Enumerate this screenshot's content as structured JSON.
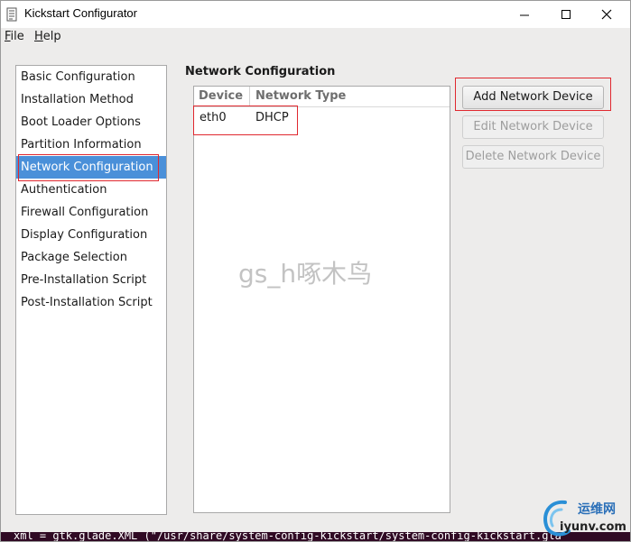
{
  "window": {
    "title": "Kickstart Configurator",
    "controls": {
      "minimize": "—",
      "maximize": "☐",
      "close": "✕"
    }
  },
  "menubar": {
    "file": {
      "mnemonic": "F",
      "rest": "ile"
    },
    "help": {
      "mnemonic": "H",
      "rest": "elp"
    }
  },
  "sidebar": {
    "items": [
      {
        "label": "Basic Configuration"
      },
      {
        "label": "Installation Method"
      },
      {
        "label": "Boot Loader Options"
      },
      {
        "label": "Partition Information"
      },
      {
        "label": "Network Configuration",
        "selected": true
      },
      {
        "label": "Authentication"
      },
      {
        "label": "Firewall Configuration"
      },
      {
        "label": "Display Configuration"
      },
      {
        "label": "Package Selection"
      },
      {
        "label": "Pre-Installation Script"
      },
      {
        "label": "Post-Installation Script"
      }
    ]
  },
  "main": {
    "title": "Network Configuration",
    "table": {
      "columns": [
        "Device",
        "Network Type"
      ],
      "rows": [
        [
          "eth0",
          "DHCP"
        ]
      ]
    },
    "buttons": {
      "add": "Add Network Device",
      "edit": "Edit Network Device",
      "delete": "Delete Network Device"
    }
  },
  "watermark": "gs_h啄木鸟",
  "terminal": {
    "text": "xml = gtk.glade.XML (\"/usr/share/system-config-kickstart/system-config-kickstart.gla"
  },
  "logo": {
    "top": "运维网",
    "bottom": "iyunv.com"
  },
  "colors": {
    "selection": "#4a90d9",
    "annotation": "#e0282f",
    "terminal_bg": "#300a24"
  }
}
